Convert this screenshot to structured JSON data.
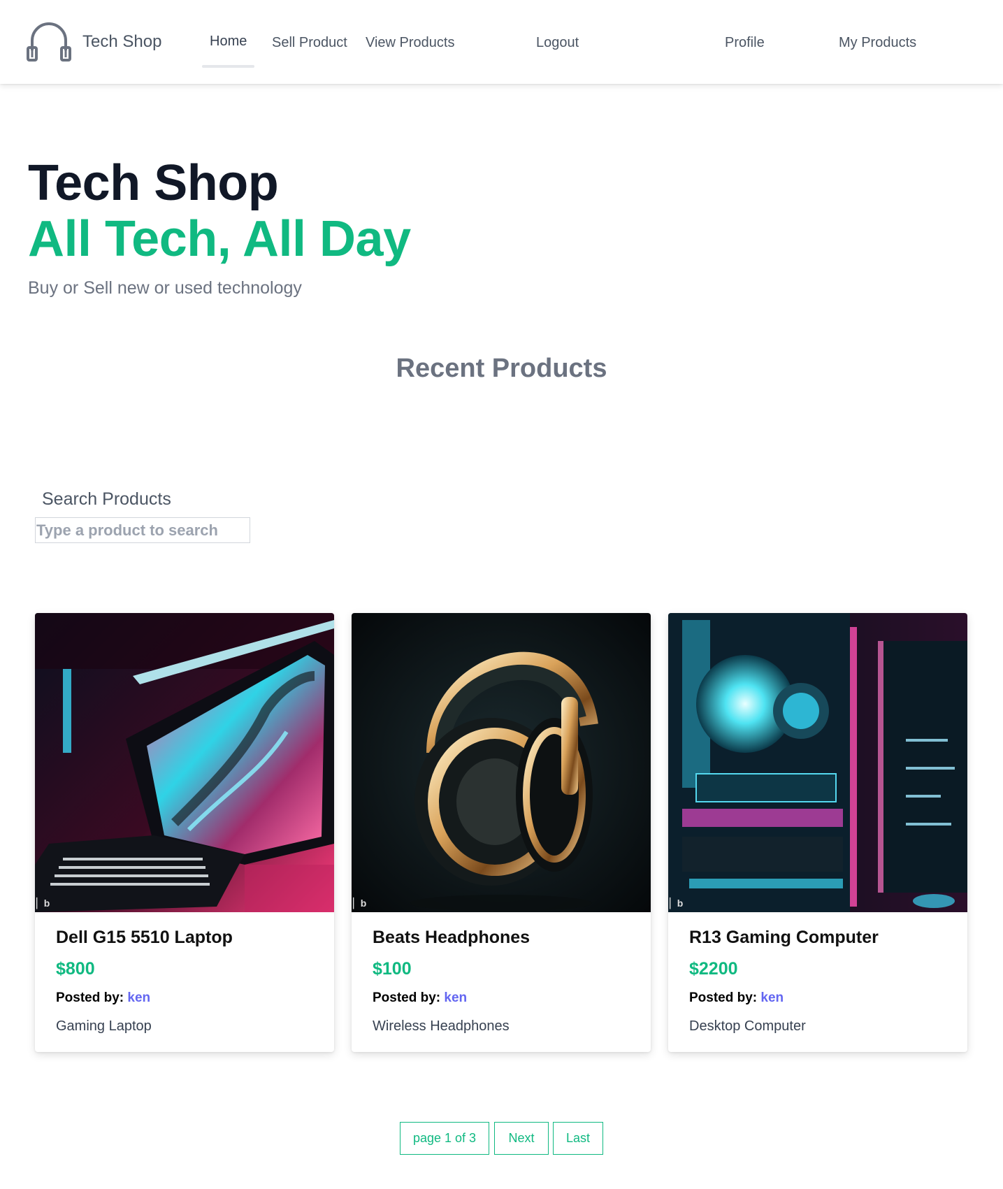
{
  "nav": {
    "brand": "Tech Shop",
    "links": [
      "Home",
      "Sell Product",
      "View Products",
      "Logout",
      "Profile",
      "My Products"
    ]
  },
  "hero": {
    "title_line1": "Tech Shop",
    "title_line2": "All Tech, All Day",
    "subtitle": "Buy or Sell new or used technology"
  },
  "recent": {
    "heading": "Recent Products"
  },
  "search": {
    "label": "Search Products",
    "placeholder": "Type a product to search"
  },
  "products": [
    {
      "title": "Dell G15 5510 Laptop",
      "price": "$800",
      "posted_label": "Posted by:",
      "poster": "ken",
      "description": "Gaming Laptop"
    },
    {
      "title": "Beats Headphones",
      "price": "$100",
      "posted_label": "Posted by:",
      "poster": "ken",
      "description": "Wireless Headphones"
    },
    {
      "title": "R13 Gaming Computer",
      "price": "$2200",
      "posted_label": "Posted by:",
      "poster": "ken",
      "description": "Desktop Computer"
    }
  ],
  "pagination": {
    "status": "page 1 of 3",
    "next": "Next",
    "last": "Last"
  },
  "colors": {
    "accent": "#10b981",
    "link": "#6366f1",
    "text_muted": "#6b7280"
  }
}
